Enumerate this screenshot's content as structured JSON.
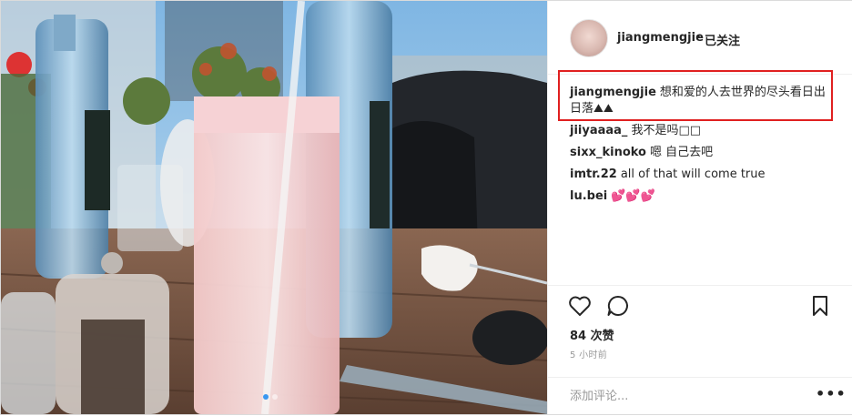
{
  "post": {
    "username": "jiangmengjie",
    "separator": "•",
    "follow_status": "已关注",
    "image_alt": "photo"
  },
  "caption": {
    "username": "jiangmengjie",
    "text_line1": "想和爱的人去世界的尽头看日出",
    "text_line2": "日落⛰⛰"
  },
  "comments": [
    {
      "username": "jiiyaaaa_",
      "text": "我不是吗□□"
    },
    {
      "username": "sixx_kinoko",
      "text": "嗯 自己去吧"
    },
    {
      "username": "imtr.22",
      "text": "all of that will come true"
    },
    {
      "username": "lu.bei",
      "text": "💕💕💕"
    }
  ],
  "engagement": {
    "likes": "84 次赞",
    "time": "5 小时前"
  },
  "add_comment": {
    "placeholder": "添加评论..."
  },
  "carousel": {
    "count": 2,
    "active": 1
  },
  "colors": {
    "accent_blue": "#3897f0",
    "highlight_red": "#e02020"
  }
}
